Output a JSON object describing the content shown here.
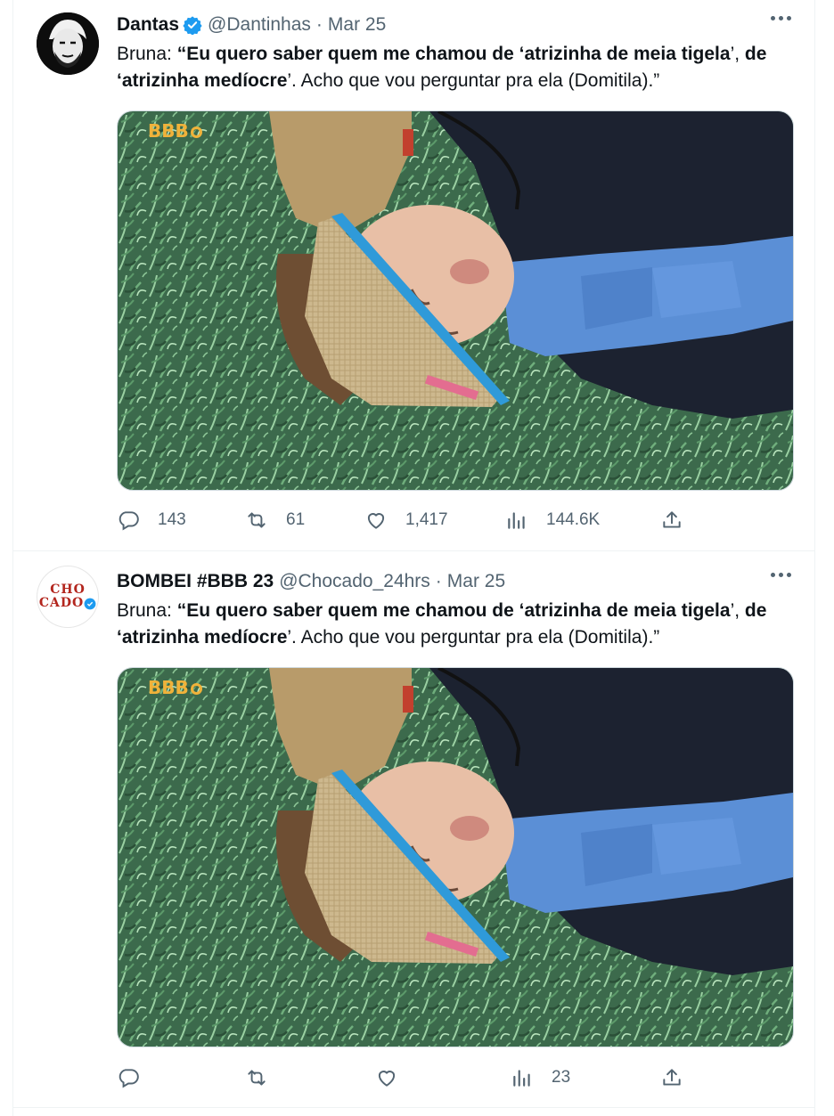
{
  "tweets": [
    {
      "author": {
        "name": "Dantas",
        "handle": "@Dantinhas",
        "verified": true
      },
      "date": "Mar 25",
      "text": {
        "speaker": "Bruna:",
        "open": "“",
        "b1": "Eu quero saber quem me chamou de ‘atrizinha de meia tigela",
        "p1": "’, ",
        "b2": "de ‘atrizinha medíocre",
        "p2": "’. Acho que vou perguntar pra ela (Domitila).”"
      },
      "media": {
        "watermark": "BBB"
      },
      "stats": {
        "replies": "143",
        "retweets": "61",
        "likes": "1,417",
        "views": "144.6K"
      }
    },
    {
      "author": {
        "name": "BOMBEI #BBB 23",
        "handle": "@Chocado_24hrs",
        "verified": true,
        "avatar_text": [
          "CHO",
          "CADO"
        ]
      },
      "date": "Mar 25",
      "text": {
        "speaker": "Bruna:",
        "open": "“",
        "b1": "Eu quero saber quem me chamou de ‘atrizinha de meia tigela",
        "p1": "’, ",
        "b2": "de ‘atrizinha medíocre",
        "p2": "’. Acho que vou perguntar pra ela (Domitila).”"
      },
      "media": {
        "watermark": "BBB"
      },
      "stats": {
        "views": "23"
      }
    }
  ],
  "icons": {
    "verified": "verified-badge-icon",
    "more": "more-dots-icon",
    "reply": "reply-icon",
    "retweet": "retweet-icon",
    "like": "heart-icon",
    "views": "views-chart-icon",
    "share": "share-icon"
  },
  "colors": {
    "text": "#0f1419",
    "secondary": "#536471",
    "verified": "#1d9bf0",
    "border": "#eff3f4",
    "grass": "#3f6a4e",
    "shirt_dark": "#1c2230",
    "shirt_blue": "#5b8fd6",
    "visor": "#c9b48b",
    "visor_edge": "#2f9ad9"
  }
}
